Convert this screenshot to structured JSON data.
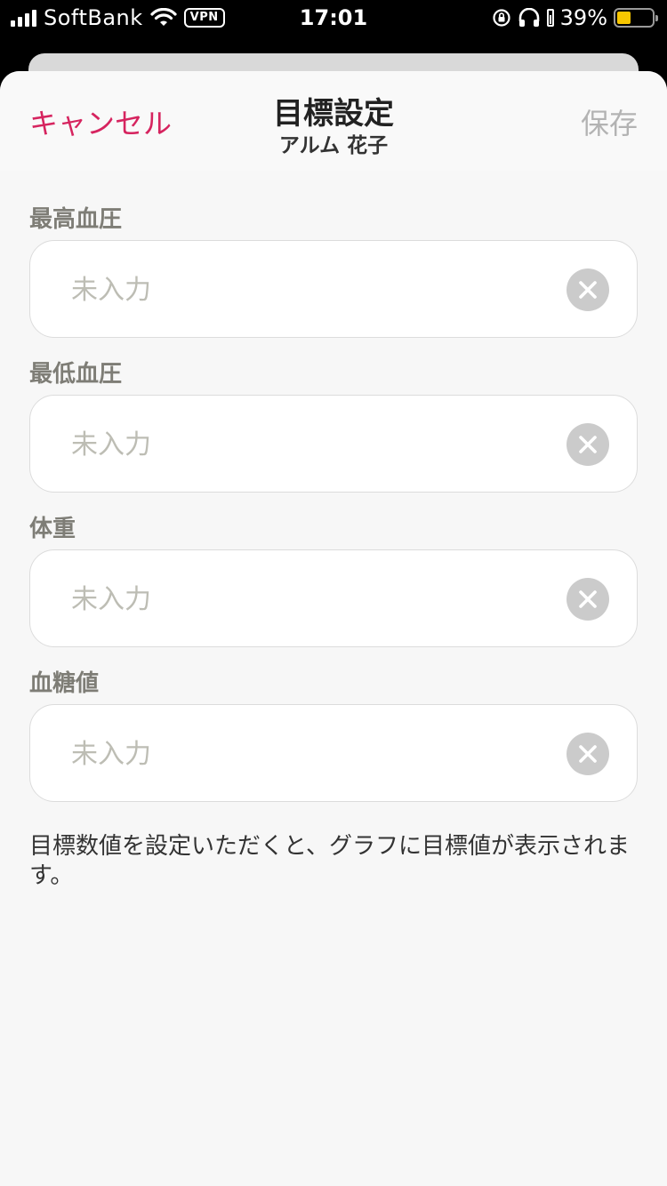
{
  "status_bar": {
    "carrier": "SoftBank",
    "vpn": "VPN",
    "time": "17:01",
    "battery_percent": "39%",
    "battery_level": 0.39,
    "battery_color": "#f7c600"
  },
  "nav": {
    "cancel_label": "キャンセル",
    "title": "目標設定",
    "subtitle": "アルム 花子",
    "save_label": "保存"
  },
  "fields": [
    {
      "label": "最高血圧",
      "placeholder": "未入力",
      "value": ""
    },
    {
      "label": "最低血圧",
      "placeholder": "未入力",
      "value": ""
    },
    {
      "label": "体重",
      "placeholder": "未入力",
      "value": ""
    },
    {
      "label": "血糖値",
      "placeholder": "未入力",
      "value": ""
    }
  ],
  "note": "目標数値を設定いただくと、グラフに目標値が表示されます。",
  "colors": {
    "accent": "#d6245f",
    "disabled": "#b3b3b3",
    "label": "#7e7d76"
  }
}
